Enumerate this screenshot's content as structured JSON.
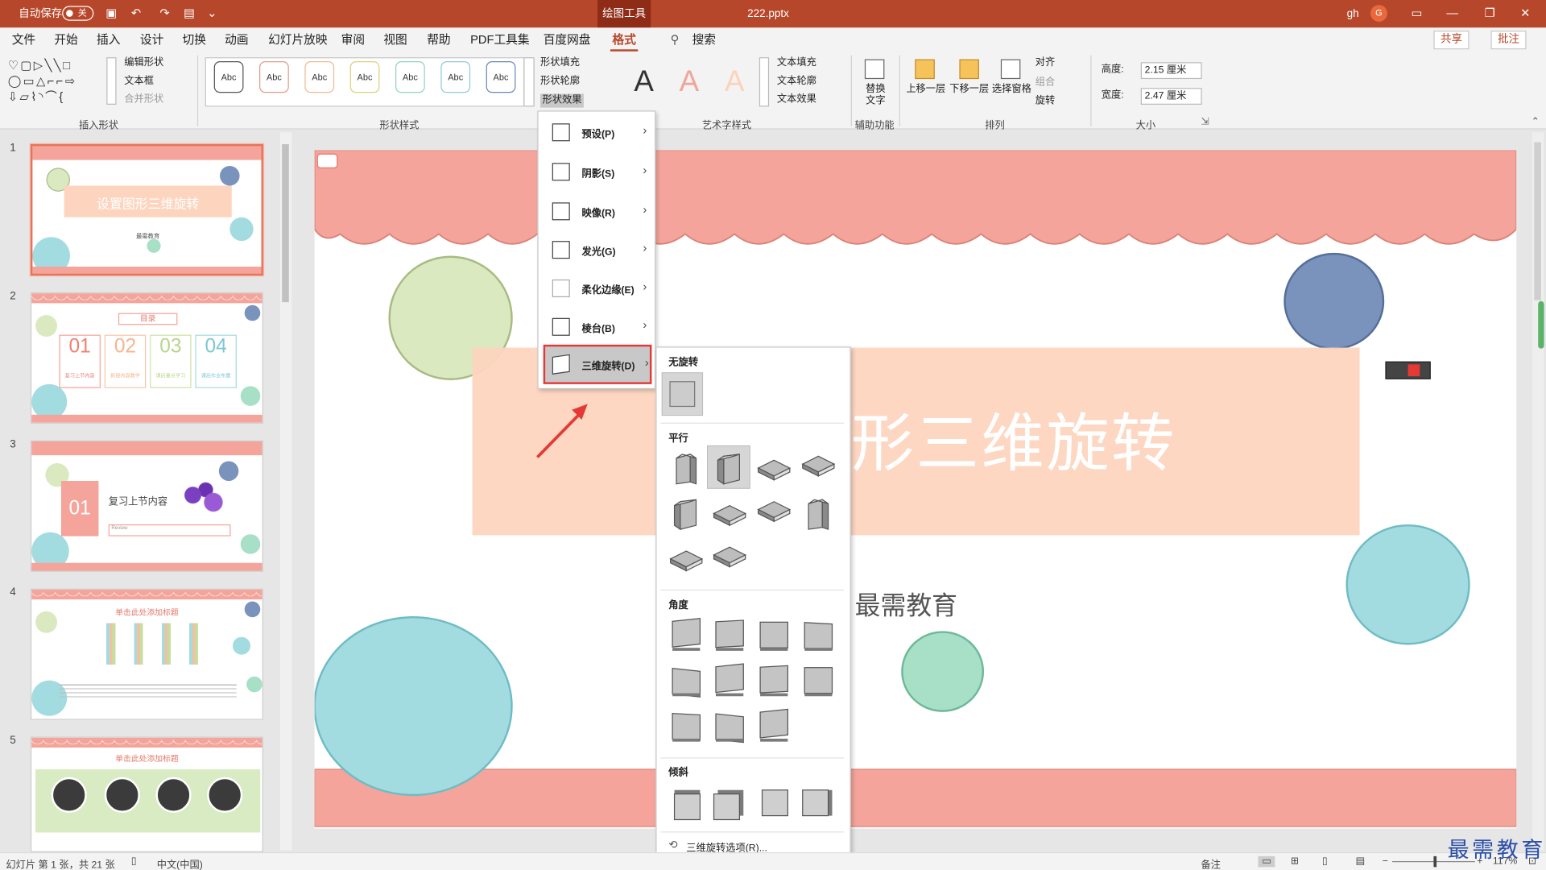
{
  "titlebar": {
    "autosave": "自动保存",
    "autosave_state": "关",
    "context_tab": "绘图工具",
    "filename": "222.pptx",
    "user": "gh",
    "avatar": "G"
  },
  "menus": [
    "文件",
    "开始",
    "插入",
    "设计",
    "切换",
    "动画",
    "幻灯片放映",
    "审阅",
    "视图",
    "帮助",
    "PDF工具集",
    "百度网盘",
    "格式"
  ],
  "search": "搜索",
  "share_label": "共享",
  "comment_label": "批注",
  "ribbon": {
    "insert_shapes": {
      "label": "插入形状",
      "edit_shape": "编辑形状",
      "text_box": "文本框",
      "merge_shapes": "合并形状"
    },
    "shape_styles": {
      "label": "形状样式",
      "preset": "Abc",
      "fill": "形状填充",
      "outline": "形状轮廓",
      "effects": "形状效果"
    },
    "wordart": {
      "label": "艺术字样式",
      "glyph": "A",
      "text_fill": "文本填充",
      "text_outline": "文本轮廓",
      "text_effects": "文本效果"
    },
    "accessibility": {
      "label": "辅助功能",
      "alt_text_line1": "替换",
      "alt_text_line2": "文字"
    },
    "arrange": {
      "label": "排列",
      "bring_forward": "上移一层",
      "send_backward": "下移一层",
      "selection_pane": "选择窗格",
      "align": "对齐",
      "group": "组合",
      "rotate": "旋转"
    },
    "size": {
      "label": "大小",
      "height_label": "高度:",
      "height_value": "2.15 厘米",
      "width_label": "宽度:",
      "width_value": "2.47 厘米"
    }
  },
  "effects_menu": [
    {
      "label": "预设(P)"
    },
    {
      "label": "阴影(S)"
    },
    {
      "label": "映像(R)"
    },
    {
      "label": "发光(G)"
    },
    {
      "label": "柔化边缘(E)"
    },
    {
      "label": "棱台(B)"
    },
    {
      "label": "三维旋转(D)",
      "selected": true
    }
  ],
  "rotation_panel": {
    "no_rotation": "无旋转",
    "parallel": "平行",
    "perspective": "角度",
    "oblique": "倾斜",
    "options": "三维旋转选项(R)..."
  },
  "slides": [
    {
      "num": "1",
      "title": "设置图形三维旋转",
      "subtitle": "最需教育"
    },
    {
      "num": "2",
      "title": "目录",
      "items": [
        "01",
        "02",
        "03",
        "04"
      ],
      "captions": [
        "复习上节内容",
        "新授内容教学",
        "课后重点学习",
        "课后作业布置"
      ]
    },
    {
      "num": "3",
      "badge": "01",
      "title": "复习上节内容",
      "note": "Review"
    },
    {
      "num": "4",
      "title": "单击此处添加标题"
    },
    {
      "num": "5",
      "title": "单击此处添加标题"
    }
  ],
  "main_slide": {
    "title": "设置图形三维旋转",
    "subtitle": "最需教育"
  },
  "statusbar": {
    "slide_info": "幻灯片 第 1 张，共 21 张",
    "language": "中文(中国)",
    "notes": "备注",
    "zoom": "117%"
  },
  "watermark": "最需教育",
  "colors": {
    "accent": "#b7472a",
    "scallop": "#f4a49a",
    "title_band": "#fdd5bf",
    "highlight": "#e53935"
  }
}
